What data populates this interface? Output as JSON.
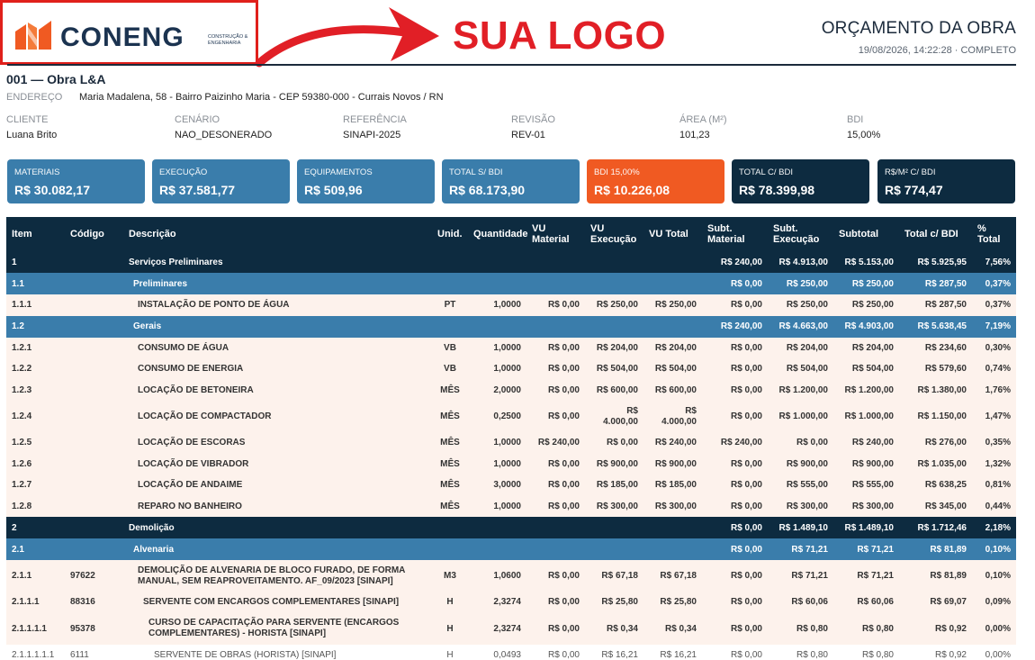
{
  "header": {
    "logo_word": "CONENG",
    "logo_sub": "CONSTRUÇÃO & ENGENHARIA",
    "callout": "SUA LOGO",
    "title": "ORÇAMENTO DA OBRA",
    "meta": "19/08/2026, 14:22:28 · COMPLETO"
  },
  "project": {
    "title": "001 — Obra L&A",
    "address_label": "ENDEREÇO",
    "address": "Maria Madalena, 58 - Bairro Paizinho Maria - CEP 59380-000 - Currais Novos / RN",
    "fields": [
      {
        "label": "CLIENTE",
        "value": "Luana Brito"
      },
      {
        "label": "CENÁRIO",
        "value": "NAO_DESONERADO"
      },
      {
        "label": "REFERÊNCIA",
        "value": "SINAPI-2025"
      },
      {
        "label": "REVISÃO",
        "value": "REV-01"
      },
      {
        "label": "ÁREA (M²)",
        "value": "101,23"
      },
      {
        "label": "BDI",
        "value": "15,00%"
      }
    ]
  },
  "cards": [
    {
      "label": "MATERIAIS",
      "value": "R$ 30.082,17",
      "color": "#3a7dab"
    },
    {
      "label": "EXECUÇÃO",
      "value": "R$ 37.581,77",
      "color": "#3a7dab"
    },
    {
      "label": "EQUIPAMENTOS",
      "value": "R$ 509,96",
      "color": "#3a7dab"
    },
    {
      "label": "TOTAL S/ BDI",
      "value": "R$ 68.173,90",
      "color": "#3a7dab"
    },
    {
      "label": "BDI 15,00%",
      "value": "R$ 10.226,08",
      "color": "#f05a22"
    },
    {
      "label": "TOTAL C/ BDI",
      "value": "R$ 78.399,98",
      "color": "#0d2b40"
    },
    {
      "label": "R$/M² C/ BDI",
      "value": "R$ 774,47",
      "color": "#0d2b40"
    }
  ],
  "table": {
    "columns": [
      "Item",
      "Código",
      "Descrição",
      "Unid.",
      "Quantidade",
      "VU Material",
      "VU Execução",
      "VU Total",
      "Subt. Material",
      "Subt. Execução",
      "Subtotal",
      "Total c/ BDI",
      "% Total"
    ],
    "rows": [
      {
        "item": "1",
        "code": "",
        "desc": "Serviços Preliminares",
        "unit": "",
        "qty": "",
        "vu_mat": "",
        "vu_exec": "",
        "vu_total": "",
        "sub_mat": "R$ 240,00",
        "sub_exec": "R$ 4.913,00",
        "subtotal": "R$ 5.153,00",
        "total_bdi": "R$ 5.925,95",
        "pct": "7,56%"
      },
      {
        "item": "1.1",
        "code": "",
        "desc": "Preliminares",
        "unit": "",
        "qty": "",
        "vu_mat": "",
        "vu_exec": "",
        "vu_total": "",
        "sub_mat": "R$ 0,00",
        "sub_exec": "R$ 250,00",
        "subtotal": "R$ 250,00",
        "total_bdi": "R$ 287,50",
        "pct": "0,37%"
      },
      {
        "item": "1.1.1",
        "code": "",
        "desc": "INSTALAÇÃO DE PONTO DE ÁGUA",
        "unit": "PT",
        "qty": "1,0000",
        "vu_mat": "R$ 0,00",
        "vu_exec": "R$ 250,00",
        "vu_total": "R$ 250,00",
        "sub_mat": "R$ 0,00",
        "sub_exec": "R$ 250,00",
        "subtotal": "R$ 250,00",
        "total_bdi": "R$ 287,50",
        "pct": "0,37%"
      },
      {
        "item": "1.2",
        "code": "",
        "desc": "Gerais",
        "unit": "",
        "qty": "",
        "vu_mat": "",
        "vu_exec": "",
        "vu_total": "",
        "sub_mat": "R$ 240,00",
        "sub_exec": "R$ 4.663,00",
        "subtotal": "R$ 4.903,00",
        "total_bdi": "R$ 5.638,45",
        "pct": "7,19%"
      },
      {
        "item": "1.2.1",
        "code": "",
        "desc": "CONSUMO DE ÁGUA",
        "unit": "VB",
        "qty": "1,0000",
        "vu_mat": "R$ 0,00",
        "vu_exec": "R$ 204,00",
        "vu_total": "R$ 204,00",
        "sub_mat": "R$ 0,00",
        "sub_exec": "R$ 204,00",
        "subtotal": "R$ 204,00",
        "total_bdi": "R$ 234,60",
        "pct": "0,30%"
      },
      {
        "item": "1.2.2",
        "code": "",
        "desc": "CONSUMO DE ENERGIA",
        "unit": "VB",
        "qty": "1,0000",
        "vu_mat": "R$ 0,00",
        "vu_exec": "R$ 504,00",
        "vu_total": "R$ 504,00",
        "sub_mat": "R$ 0,00",
        "sub_exec": "R$ 504,00",
        "subtotal": "R$ 504,00",
        "total_bdi": "R$ 579,60",
        "pct": "0,74%"
      },
      {
        "item": "1.2.3",
        "code": "",
        "desc": "LOCAÇÃO DE BETONEIRA",
        "unit": "MÊS",
        "qty": "2,0000",
        "vu_mat": "R$ 0,00",
        "vu_exec": "R$ 600,00",
        "vu_total": "R$ 600,00",
        "sub_mat": "R$ 0,00",
        "sub_exec": "R$ 1.200,00",
        "subtotal": "R$ 1.200,00",
        "total_bdi": "R$ 1.380,00",
        "pct": "1,76%"
      },
      {
        "item": "1.2.4",
        "code": "",
        "desc": "LOCAÇÃO DE COMPACTADOR",
        "unit": "MÊS",
        "qty": "0,2500",
        "vu_mat": "R$ 0,00",
        "vu_exec": "R$ 4.000,00",
        "vu_total": "R$ 4.000,00",
        "sub_mat": "R$ 0,00",
        "sub_exec": "R$ 1.000,00",
        "subtotal": "R$ 1.000,00",
        "total_bdi": "R$ 1.150,00",
        "pct": "1,47%"
      },
      {
        "item": "1.2.5",
        "code": "",
        "desc": "LOCAÇÃO DE ESCORAS",
        "unit": "MÊS",
        "qty": "1,0000",
        "vu_mat": "R$ 240,00",
        "vu_exec": "R$ 0,00",
        "vu_total": "R$ 240,00",
        "sub_mat": "R$ 240,00",
        "sub_exec": "R$ 0,00",
        "subtotal": "R$ 240,00",
        "total_bdi": "R$ 276,00",
        "pct": "0,35%"
      },
      {
        "item": "1.2.6",
        "code": "",
        "desc": "LOCAÇÃO DE VIBRADOR",
        "unit": "MÊS",
        "qty": "1,0000",
        "vu_mat": "R$ 0,00",
        "vu_exec": "R$ 900,00",
        "vu_total": "R$ 900,00",
        "sub_mat": "R$ 0,00",
        "sub_exec": "R$ 900,00",
        "subtotal": "R$ 900,00",
        "total_bdi": "R$ 1.035,00",
        "pct": "1,32%"
      },
      {
        "item": "1.2.7",
        "code": "",
        "desc": "LOCAÇÃO DE ANDAIME",
        "unit": "MÊS",
        "qty": "3,0000",
        "vu_mat": "R$ 0,00",
        "vu_exec": "R$ 185,00",
        "vu_total": "R$ 185,00",
        "sub_mat": "R$ 0,00",
        "sub_exec": "R$ 555,00",
        "subtotal": "R$ 555,00",
        "total_bdi": "R$ 638,25",
        "pct": "0,81%"
      },
      {
        "item": "1.2.8",
        "code": "",
        "desc": "REPARO NO BANHEIRO",
        "unit": "MÊS",
        "qty": "1,0000",
        "vu_mat": "R$ 0,00",
        "vu_exec": "R$ 300,00",
        "vu_total": "R$ 300,00",
        "sub_mat": "R$ 0,00",
        "sub_exec": "R$ 300,00",
        "subtotal": "R$ 300,00",
        "total_bdi": "R$ 345,00",
        "pct": "0,44%"
      },
      {
        "item": "2",
        "code": "",
        "desc": "Demolição",
        "unit": "",
        "qty": "",
        "vu_mat": "",
        "vu_exec": "",
        "vu_total": "",
        "sub_mat": "R$ 0,00",
        "sub_exec": "R$ 1.489,10",
        "subtotal": "R$ 1.489,10",
        "total_bdi": "R$ 1.712,46",
        "pct": "2,18%"
      },
      {
        "item": "2.1",
        "code": "",
        "desc": "Alvenaria",
        "unit": "",
        "qty": "",
        "vu_mat": "",
        "vu_exec": "",
        "vu_total": "",
        "sub_mat": "R$ 0,00",
        "sub_exec": "R$ 71,21",
        "subtotal": "R$ 71,21",
        "total_bdi": "R$ 81,89",
        "pct": "0,10%"
      },
      {
        "item": "2.1.1",
        "code": "97622",
        "desc": "DEMOLIÇÃO DE ALVENARIA DE BLOCO FURADO, DE FORMA MANUAL, SEM REAPROVEITAMENTO. AF_09/2023  [SINAPI]",
        "unit": "M3",
        "qty": "1,0600",
        "vu_mat": "R$ 0,00",
        "vu_exec": "R$ 67,18",
        "vu_total": "R$ 67,18",
        "sub_mat": "R$ 0,00",
        "sub_exec": "R$ 71,21",
        "subtotal": "R$ 71,21",
        "total_bdi": "R$ 81,89",
        "pct": "0,10%"
      },
      {
        "item": "2.1.1.1",
        "code": "88316",
        "desc": "SERVENTE COM ENCARGOS COMPLEMENTARES  [SINAPI]",
        "unit": "H",
        "qty": "2,3274",
        "vu_mat": "R$ 0,00",
        "vu_exec": "R$ 25,80",
        "vu_total": "R$ 25,80",
        "sub_mat": "R$ 0,00",
        "sub_exec": "R$ 60,06",
        "subtotal": "R$ 60,06",
        "total_bdi": "R$ 69,07",
        "pct": "0,09%"
      },
      {
        "item": "2.1.1.1.1",
        "code": "95378",
        "desc": "CURSO DE CAPACITAÇÃO PARA SERVENTE (ENCARGOS COMPLEMENTARES) - HORISTA  [SINAPI]",
        "unit": "H",
        "qty": "2,3274",
        "vu_mat": "R$ 0,00",
        "vu_exec": "R$ 0,34",
        "vu_total": "R$ 0,34",
        "sub_mat": "R$ 0,00",
        "sub_exec": "R$ 0,80",
        "subtotal": "R$ 0,80",
        "total_bdi": "R$ 0,92",
        "pct": "0,00%"
      },
      {
        "item": "2.1.1.1.1.1",
        "code": "6111",
        "desc": "SERVENTE DE OBRAS (HORISTA)  [SINAPI]",
        "unit": "H",
        "qty": "0,0493",
        "vu_mat": "R$ 0,00",
        "vu_exec": "R$ 16,21",
        "vu_total": "R$ 16,21",
        "sub_mat": "R$ 0,00",
        "sub_exec": "R$ 0,80",
        "subtotal": "R$ 0,80",
        "total_bdi": "R$ 0,92",
        "pct": "0,00%"
      }
    ]
  }
}
